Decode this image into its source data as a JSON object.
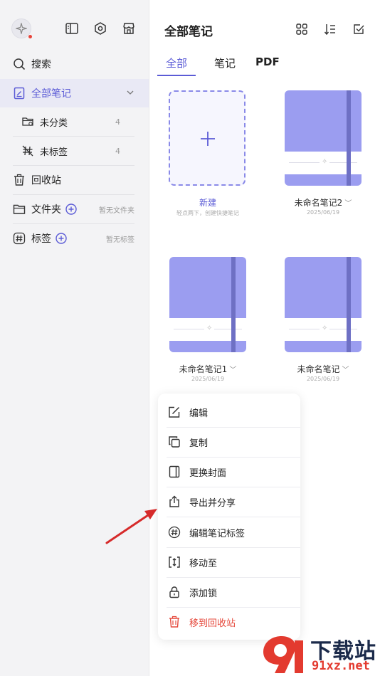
{
  "sidebar": {
    "search": "搜索",
    "all_notes": "全部笔记",
    "uncategorized": "未分类",
    "uncategorized_count": "4",
    "untagged": "未标签",
    "untagged_count": "4",
    "recycle_bin": "回收站",
    "folders": "文件夹",
    "folders_empty": "暂无文件夹",
    "tags": "标签",
    "tags_empty": "暂无标签"
  },
  "main": {
    "title": "全部笔记",
    "tabs": [
      "全部",
      "笔记",
      "PDF"
    ],
    "new_card": {
      "label": "新建",
      "hint": "轻点两下，创建快捷笔记"
    },
    "notes": [
      {
        "name": "未命名笔记2",
        "date": "2025/06/19"
      },
      {
        "name": "未命名笔记1",
        "date": "2025/06/19"
      },
      {
        "name": "未命名笔记",
        "date": "2025/06/19"
      }
    ]
  },
  "menu": {
    "items": [
      "编辑",
      "复制",
      "更换封面",
      "导出并分享",
      "编辑笔记标签",
      "移动至",
      "添加锁",
      "移到回收站"
    ]
  },
  "watermark": {
    "text": "下载站",
    "url": "91xz.net"
  },
  "colors": {
    "accent": "#5b5bd6",
    "cover": "#9b9df0",
    "spine": "#6e70c4",
    "danger": "#e5483b"
  }
}
